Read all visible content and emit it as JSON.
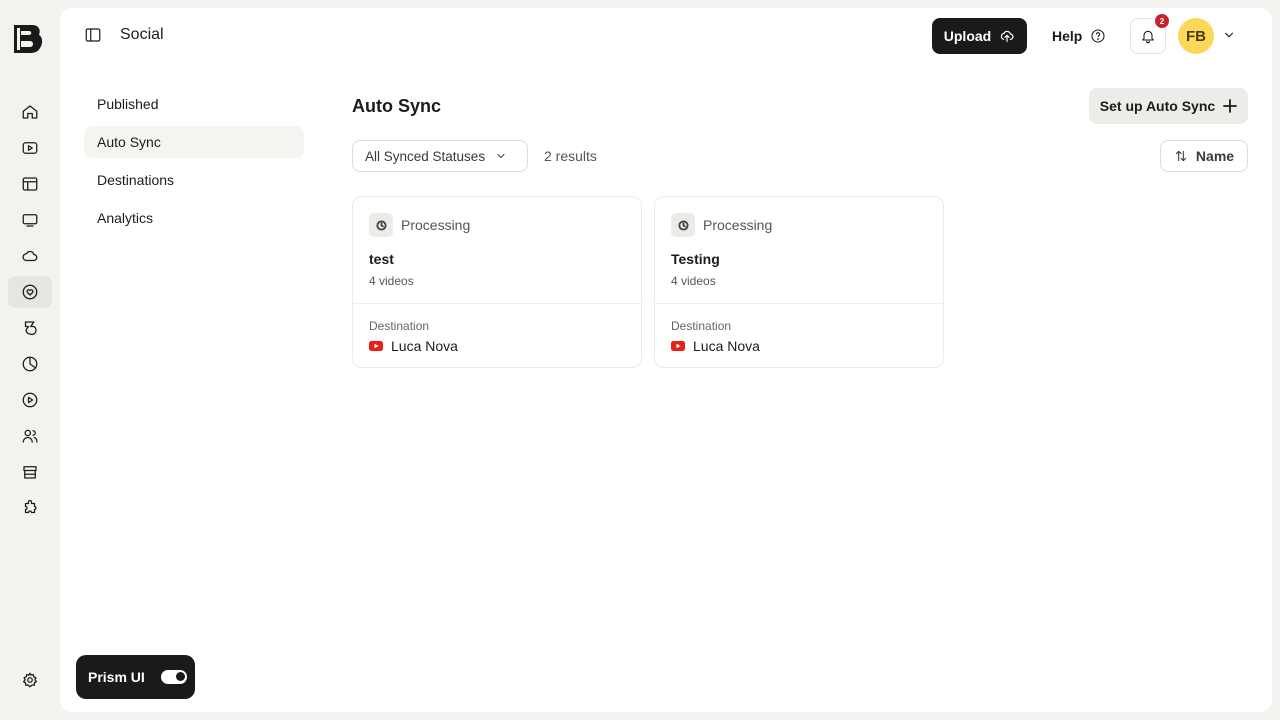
{
  "app": {
    "section": "Social"
  },
  "rail": {
    "items": [
      {
        "icon": "home-icon",
        "active": false
      },
      {
        "icon": "video-play-icon",
        "active": false
      },
      {
        "icon": "layout-icon",
        "active": false
      },
      {
        "icon": "monitor-icon",
        "active": false
      },
      {
        "icon": "cloud-icon",
        "active": false
      },
      {
        "icon": "heart-circle-icon",
        "active": true
      },
      {
        "icon": "brand-icon",
        "active": false
      },
      {
        "icon": "pie-chart-icon",
        "active": false
      },
      {
        "icon": "play-circle-icon",
        "active": false
      },
      {
        "icon": "users-icon",
        "active": false
      },
      {
        "icon": "storefront-icon",
        "active": false
      },
      {
        "icon": "puzzle-icon",
        "active": false
      }
    ],
    "settings_icon": "gear-icon"
  },
  "header": {
    "upload_label": "Upload",
    "help_label": "Help",
    "notification_count": "2",
    "avatar_initials": "FB"
  },
  "subnav": {
    "items": [
      {
        "label": "Published",
        "active": false
      },
      {
        "label": "Auto Sync",
        "active": true
      },
      {
        "label": "Destinations",
        "active": false
      },
      {
        "label": "Analytics",
        "active": false
      }
    ]
  },
  "main": {
    "title": "Auto Sync",
    "setup_label": "Set up Auto Sync",
    "filter_label": "All Synced Statuses",
    "results_text": "2 results",
    "sort_label": "Name",
    "cards": [
      {
        "status": "Processing",
        "name": "test",
        "count": "4 videos",
        "destination_label": "Destination",
        "destination": "Luca Nova"
      },
      {
        "status": "Processing",
        "name": "Testing",
        "count": "4 videos",
        "destination_label": "Destination",
        "destination": "Luca Nova"
      }
    ]
  },
  "prism": {
    "label": "Prism UI",
    "enabled": true
  },
  "colors": {
    "accent_dark": "#1a1a1a",
    "avatar_bg": "#fbd85a",
    "badge_red": "#c8232b",
    "youtube_red": "#e62117"
  }
}
